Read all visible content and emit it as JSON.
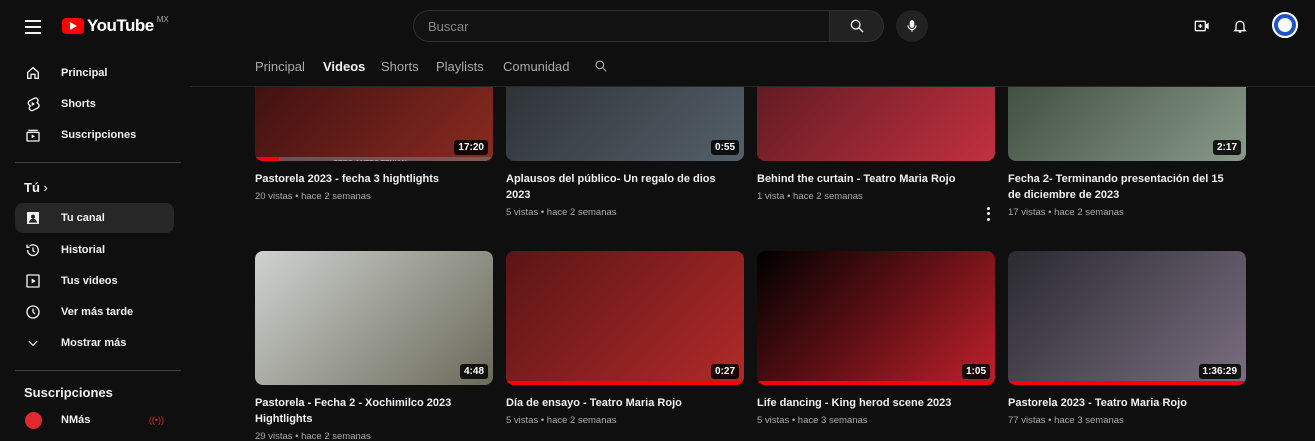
{
  "header": {
    "logo_text": "YouTube",
    "country": "MX",
    "search_placeholder": "Buscar"
  },
  "sidebar": {
    "main": [
      {
        "label": "Principal",
        "icon": "home-icon"
      },
      {
        "label": "Shorts",
        "icon": "shorts-icon"
      },
      {
        "label": "Suscripciones",
        "icon": "subscriptions-icon"
      }
    ],
    "you_title": "Tú",
    "you_items": [
      {
        "label": "Tu canal",
        "icon": "channel-icon",
        "active": true
      },
      {
        "label": "Historial",
        "icon": "history-icon"
      },
      {
        "label": "Tus videos",
        "icon": "your-videos-icon"
      },
      {
        "label": "Ver más tarde",
        "icon": "watch-later-icon"
      },
      {
        "label": "Mostrar más",
        "icon": "chevron-down-icon"
      }
    ],
    "subs_title": "Suscripciones",
    "subs": [
      {
        "label": "NMás",
        "icon": "live-icon"
      }
    ]
  },
  "tabs": [
    "Principal",
    "Videos",
    "Shorts",
    "Playlists",
    "Comunidad"
  ],
  "active_tab": "Videos",
  "videos": [
    {
      "title": "Pastorela 2023 - fecha 3 hightlights",
      "meta": "20 vistas • hace 2 semanas",
      "duration": "17:20",
      "overlay": "PERO ANTES TENIAN QUE PASAR POR EL CASTILLO DEL REY HERODES",
      "watched": 0.1
    },
    {
      "title": "Aplausos del público- Un regalo de dios 2023",
      "meta": "5 vistas • hace 2 semanas",
      "duration": "0:55",
      "watched": 0
    },
    {
      "title": "Behind the curtain - Teatro Maria Rojo",
      "meta": "1 vista • hace 2 semanas",
      "duration": "",
      "watched": 0
    },
    {
      "title": "Fecha 2- Terminando presentación del 15 de diciembre de 2023",
      "meta": "17 vistas • hace 2 semanas",
      "duration": "2:17",
      "watched": 0
    },
    {
      "title": "Pastorela - Fecha 2 - Xochimilco 2023 Hightlights",
      "meta": "29 vistas • hace 2 semanas",
      "duration": "4:48",
      "watched": 0
    },
    {
      "title": "Día de ensayo - Teatro Maria Rojo",
      "meta": "5 vistas • hace 2 semanas",
      "duration": "0:27",
      "watched": 1
    },
    {
      "title": "Life dancing - King herod scene 2023",
      "meta": "5 vistas • hace 3 semanas",
      "duration": "1:05",
      "watched": 1
    },
    {
      "title": "Pastorela 2023 - Teatro Maria Rojo",
      "meta": "77 vistas • hace 3 semanas",
      "duration": "1:36:29",
      "watched": 1
    }
  ],
  "thumb_colors": [
    [
      "#3a1010",
      "#8a2a20"
    ],
    [
      "#2b2f33",
      "#55606a"
    ],
    [
      "#5a1a20",
      "#c23040"
    ],
    [
      "#3b4a3a",
      "#8a9a8a"
    ],
    [
      "#cfd2d0",
      "#6a6a5a"
    ],
    [
      "#5a1515",
      "#b22a2a"
    ],
    [
      "#000000",
      "#c0202a"
    ],
    [
      "#2a2a30",
      "#7a6e80"
    ]
  ]
}
